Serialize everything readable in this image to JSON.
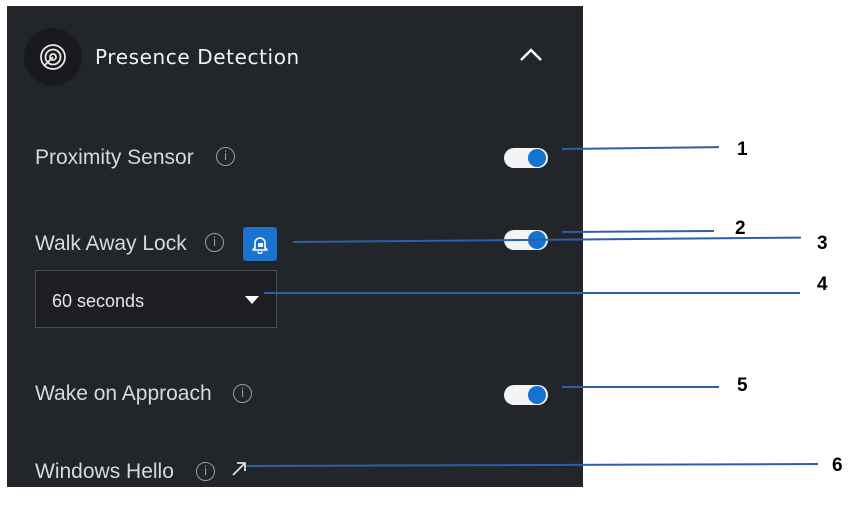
{
  "panel": {
    "title": "Presence Detection",
    "icon": "radar-icon",
    "collapse_icon": "chevron-up-icon"
  },
  "rows": {
    "proximity_sensor": {
      "label": "Proximity Sensor",
      "toggle_on": true
    },
    "walk_away_lock": {
      "label": "Walk Away Lock",
      "toggle_on": true,
      "lock_button_icon": "lock-bell-icon",
      "timeout_select": {
        "value": "60 seconds"
      }
    },
    "wake_on_approach": {
      "label": "Wake on Approach",
      "toggle_on": true
    },
    "windows_hello": {
      "label": "Windows Hello",
      "link_icon": "external-arrow-icon"
    }
  },
  "info_glyph": "i",
  "callouts": [
    "1",
    "2",
    "3",
    "4",
    "5",
    "6"
  ],
  "colors": {
    "panel_bg": "#22252a",
    "accent": "#1472d0",
    "callout_line": "#2f5ea8"
  }
}
